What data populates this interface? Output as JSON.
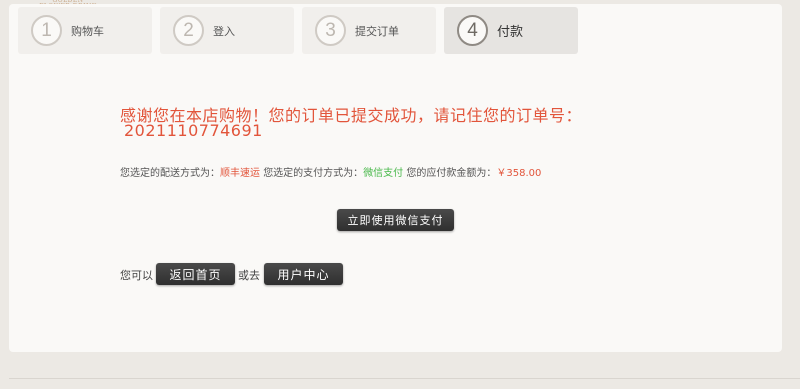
{
  "logo": {
    "text": "GOLDEN FLOWER DRINK"
  },
  "steps": [
    {
      "num": "1",
      "label": "购物车"
    },
    {
      "num": "2",
      "label": "登入"
    },
    {
      "num": "3",
      "label": "提交订单"
    },
    {
      "num": "4",
      "label": "付款",
      "active": true
    }
  ],
  "success": {
    "title": "感谢您在本店购物！您的订单已提交成功，请记住您的订单号：",
    "order_no": "2021110774691"
  },
  "info": {
    "delivery_label": "您选定的配送方式为：",
    "delivery_value": "顺丰速运",
    "payment_label": "您选定的支付方式为：",
    "payment_value": "微信支付",
    "amount_label": "您的应付款金额为：",
    "amount_value": "￥358.00"
  },
  "actions": {
    "pay_label": "立即使用微信支付",
    "prefix": "您可以",
    "home_label": "返回首页",
    "or": "或去",
    "user_label": "用户中心"
  },
  "colors": {
    "accent_red": "#e2553b",
    "accent_green": "#48b84a",
    "button_dark": "#333333"
  }
}
